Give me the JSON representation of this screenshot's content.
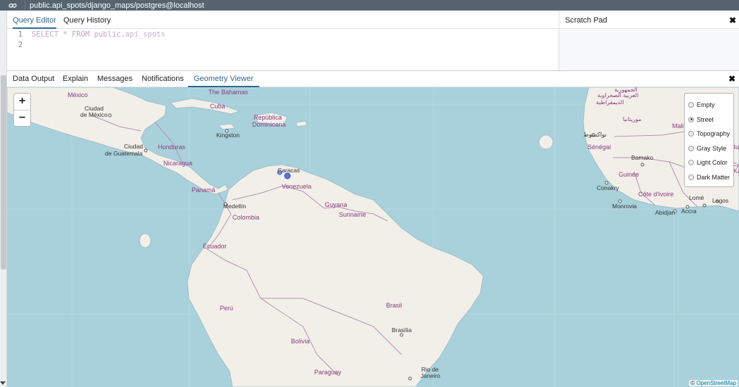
{
  "window": {
    "title": "public.api_spots/django_maps/postgres@localhost",
    "link_icon": "link-icon"
  },
  "editor_tabs": [
    {
      "label": "Query Editor",
      "active": true
    },
    {
      "label": "Query History",
      "active": false
    }
  ],
  "scratch_pad": {
    "label": "Scratch Pad",
    "close_icon": "close-icon"
  },
  "editor": {
    "line_numbers": [
      "1",
      "2"
    ],
    "line1": {
      "kw1": "SELECT",
      "op": " * ",
      "kw2": "FROM",
      "space": " ",
      "schema": "public",
      "dot": ".",
      "table": "api_spots"
    }
  },
  "output_tabs": [
    {
      "label": "Data Output",
      "active": false
    },
    {
      "label": "Explain",
      "active": false
    },
    {
      "label": "Messages",
      "active": false
    },
    {
      "label": "Notifications",
      "active": false
    },
    {
      "label": "Geometry Viewer",
      "active": true
    }
  ],
  "map": {
    "zoom_in": "+",
    "zoom_out": "−",
    "layers": [
      {
        "label": "Empty",
        "selected": false
      },
      {
        "label": "Street",
        "selected": true
      },
      {
        "label": "Topography",
        "selected": false
      },
      {
        "label": "Gray Style",
        "selected": false
      },
      {
        "label": "Light Color",
        "selected": false
      },
      {
        "label": "Dark Matter",
        "selected": false
      }
    ],
    "attribution_prefix": "© ",
    "attribution_link": "OpenStreetMap",
    "colors": {
      "sea": "#a9d1dc",
      "land": "#f2efe9",
      "border": "#b68fb7",
      "marker": "#3f5cd8"
    },
    "labels": {
      "the_bahamas": "The Bahamas",
      "mexico": "México",
      "ciudad_de_mexico_1": "Ciudad",
      "ciudad_de_mexico_2": "de México",
      "cuba": "Cuba",
      "republica_1": "República",
      "republica_2": "Dominicana",
      "kingston": "Kingston",
      "ciudad_guatemala_1": "Ciudad",
      "ciudad_guatemala_2": "de Guatemala",
      "honduras": "Honduras",
      "nicaragua": "Nicaragua",
      "panama": "Panamá",
      "caracas": "Caracas",
      "venezuela": "Venezuela",
      "guyana": "Guyana",
      "suriname": "Suriname",
      "medellin": "Medellín",
      "colombia": "Colombia",
      "ecuador": "Ecuador",
      "peru": "Perú",
      "brasil": "Brasil",
      "brasilia": "Brasília",
      "bolivia": "Bolivia",
      "paraguay": "Paraguay",
      "rio_1": "Rio de",
      "rio_2": "Janeiro",
      "western_sahara_1": "الجمهورية",
      "western_sahara_2": "العربية الصحراوية",
      "western_sahara_3": "الديمقراطية",
      "mauritania": "موريتانيا",
      "nouakchott": "نواكشوط",
      "mali": "Mali",
      "senegal": "Sénégal",
      "bamako": "Bamako",
      "guinee": "Guinée",
      "conakry": "Conakry",
      "cote_divoire": "Côte d'Ivoire",
      "monrovia": "Monrovia",
      "abidjan": "Abidjan",
      "accra": "Accra",
      "lome": "Lomé",
      "lagos": "Lagos",
      "burkina_partial": "Bur",
      "burkina_partial_2": "Fa",
      "ka_partial": "Ka"
    }
  }
}
